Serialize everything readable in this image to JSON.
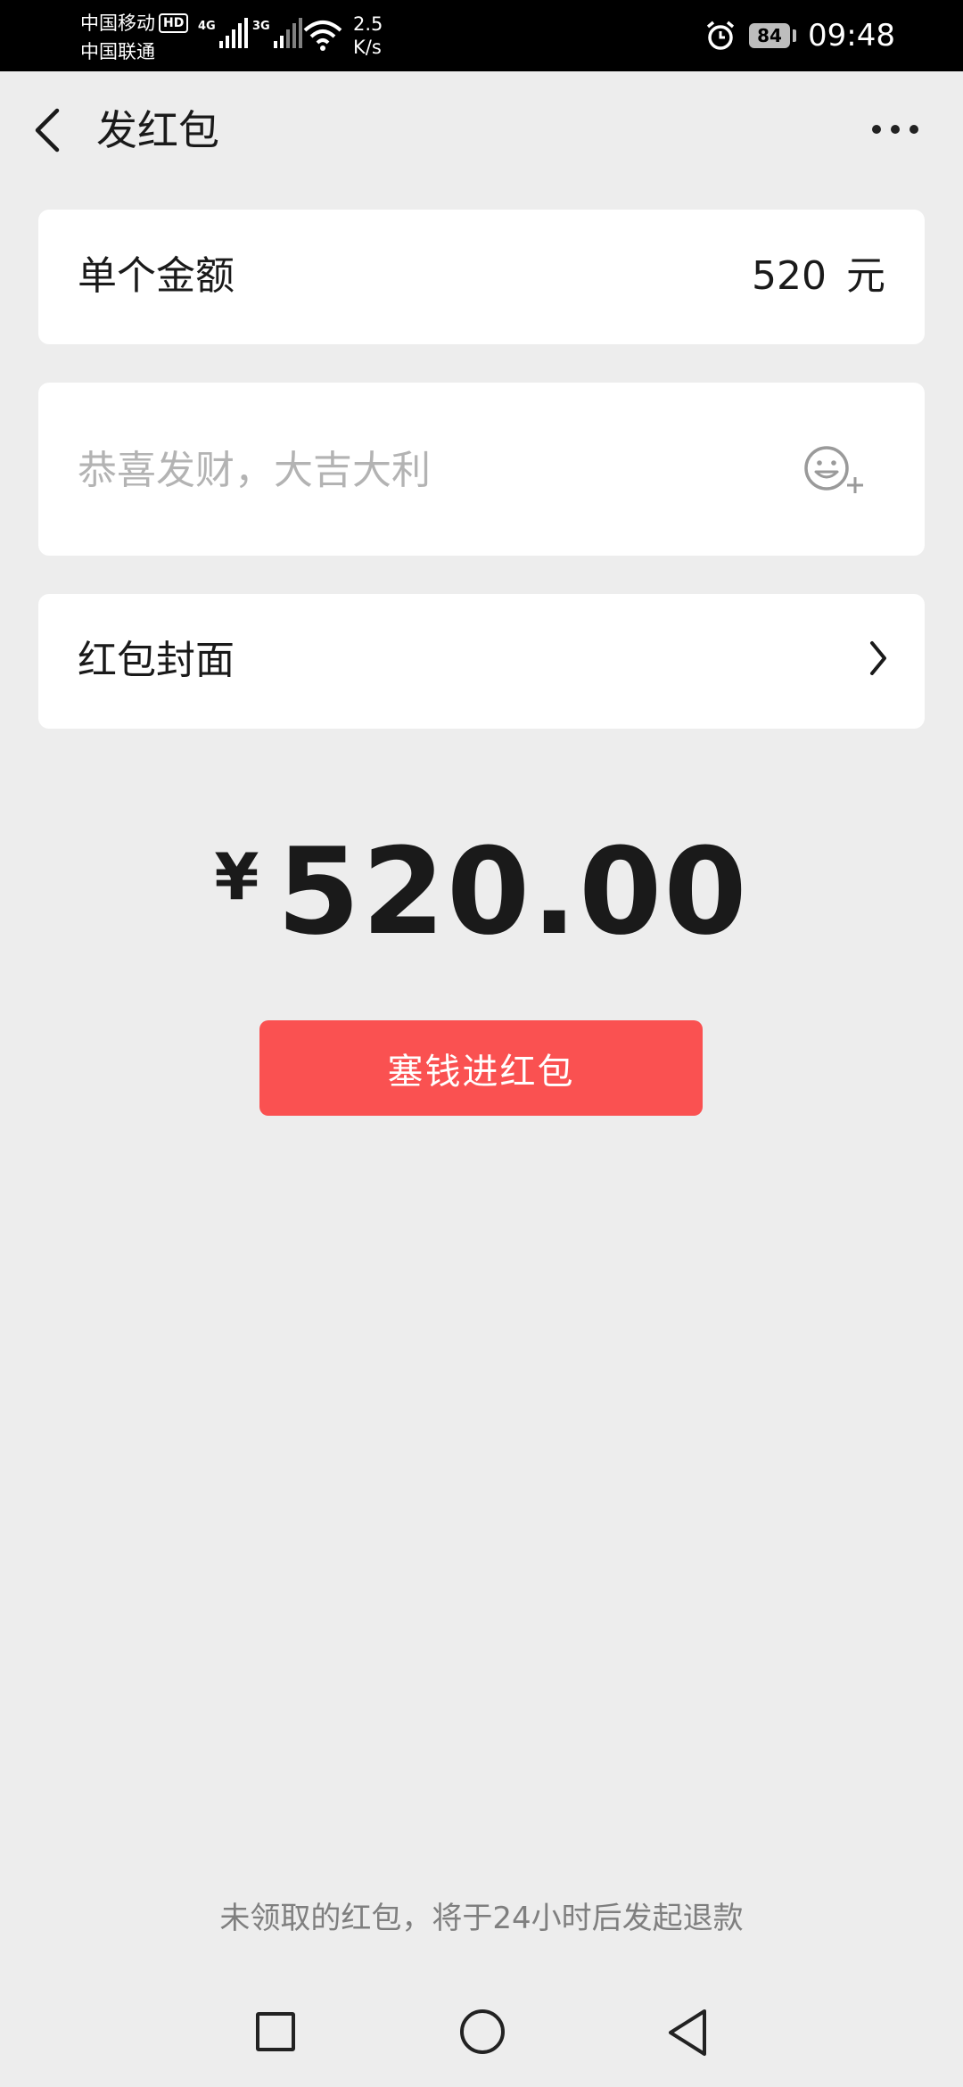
{
  "status_bar": {
    "carrier_1": "中国移动",
    "carrier_2": "中国联通",
    "hd_badge": "HD",
    "net_1": "4G",
    "net_2": "3G",
    "speed_value": "2.5",
    "speed_unit": "K/s",
    "battery_level": "84",
    "time": "09:48"
  },
  "nav": {
    "title": "发红包"
  },
  "amount_row": {
    "label": "单个金额",
    "value": "520",
    "unit": "元"
  },
  "greeting": {
    "placeholder": "恭喜发财，大吉大利"
  },
  "cover_row": {
    "label": "红包封面"
  },
  "total": {
    "currency": "¥",
    "value": "520.00"
  },
  "send_button": {
    "label": "塞钱进红包"
  },
  "refund_note": "未领取的红包，将于24小时后发起退款",
  "colors": {
    "accent_red": "#fa5151",
    "background": "#ededed",
    "card": "#ffffff"
  },
  "icons": {
    "back": "back-arrow-icon",
    "more": "more-icon",
    "emoji": "emoji-add-icon",
    "chevron": "chevron-right-icon",
    "sys_recents": "recents-square-icon",
    "sys_home": "home-circle-icon",
    "sys_back": "back-triangle-icon"
  }
}
